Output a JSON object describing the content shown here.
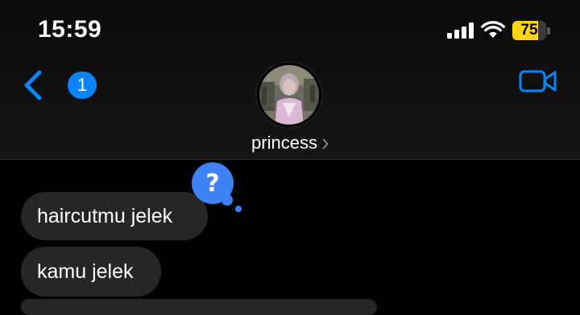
{
  "status_bar": {
    "time": "15:59",
    "battery_level": "75",
    "battery_percent": 75,
    "battery_color": "#ffd60a",
    "icons": [
      "cellular-signal-icon",
      "wifi-icon",
      "battery-icon"
    ]
  },
  "header": {
    "back_badge_count": "1",
    "contact_name": "princess",
    "accent_color": "#0a84ff",
    "icons": [
      "chevron-left-icon",
      "video-camera-icon",
      "chevron-right-icon"
    ]
  },
  "messages": [
    {
      "text": "haircutmu jelek",
      "direction": "incoming",
      "reaction": "question-mark"
    },
    {
      "text": "kamu jelek",
      "direction": "incoming"
    },
    {
      "text": "",
      "direction": "incoming"
    }
  ],
  "colors": {
    "background": "#000000",
    "incoming_bubble": "#262628",
    "reaction_badge": "#3d82f6"
  }
}
